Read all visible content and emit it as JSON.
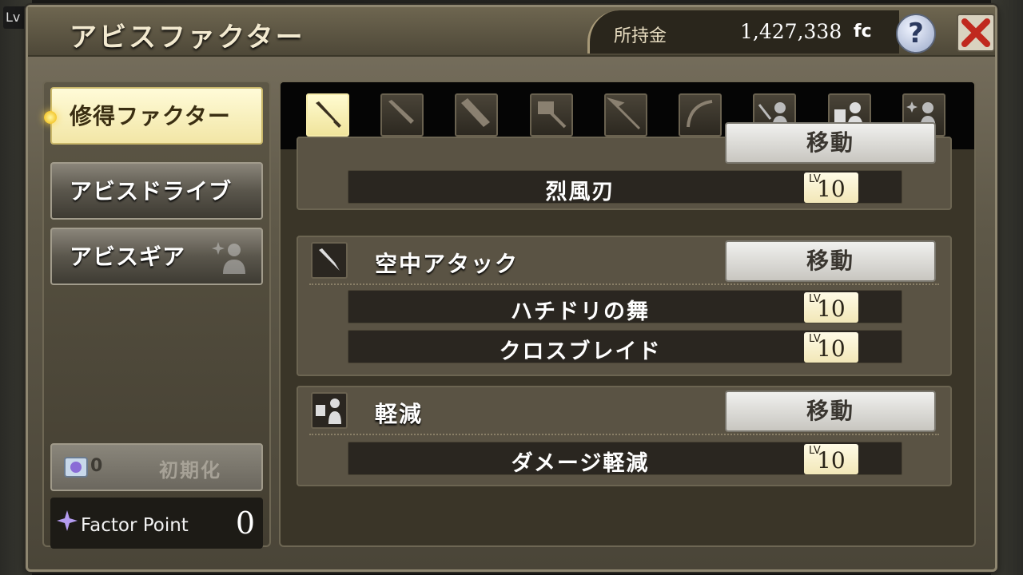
{
  "hud": {
    "lv_label": "Lv"
  },
  "window": {
    "title": "アビスファクター",
    "money_label": "所持金",
    "money_value": "1,427,338",
    "money_unit": "fc",
    "help_label": "?"
  },
  "sidebar": {
    "items": [
      {
        "label": "修得ファクター",
        "active": true
      },
      {
        "label": "アビスドライブ",
        "active": false
      },
      {
        "label": "アビスギア",
        "active": false
      }
    ],
    "reset": {
      "count": "0",
      "label": "初期化"
    },
    "factor_point": {
      "label": "Factor Point",
      "value": "0"
    }
  },
  "tabs": [
    {
      "icon": "blade-icon",
      "active": true
    },
    {
      "icon": "sword-icon",
      "active": false
    },
    {
      "icon": "great-sword-icon",
      "active": false
    },
    {
      "icon": "hammer-icon",
      "active": false
    },
    {
      "icon": "spear-icon",
      "active": false
    },
    {
      "icon": "scythe-icon",
      "active": false
    },
    {
      "icon": "weapon-person-icon",
      "active": false
    },
    {
      "icon": "armor-person-icon",
      "active": false
    },
    {
      "icon": "sparkle-person-icon",
      "active": false
    }
  ],
  "groups": [
    {
      "title": "",
      "move_label": "移動",
      "skills": [
        {
          "name": "烈風刃",
          "lv_label": "LV",
          "lv": "10"
        }
      ]
    },
    {
      "title": "空中アタック",
      "move_label": "移動",
      "skills": [
        {
          "name": "ハチドリの舞",
          "lv_label": "LV",
          "lv": "10"
        },
        {
          "name": "クロスブレイド",
          "lv_label": "LV",
          "lv": "10"
        }
      ]
    },
    {
      "title": "軽減",
      "move_label": "移動",
      "skills": [
        {
          "name": "ダメージ軽減",
          "lv_label": "LV",
          "lv": "10"
        }
      ]
    }
  ]
}
